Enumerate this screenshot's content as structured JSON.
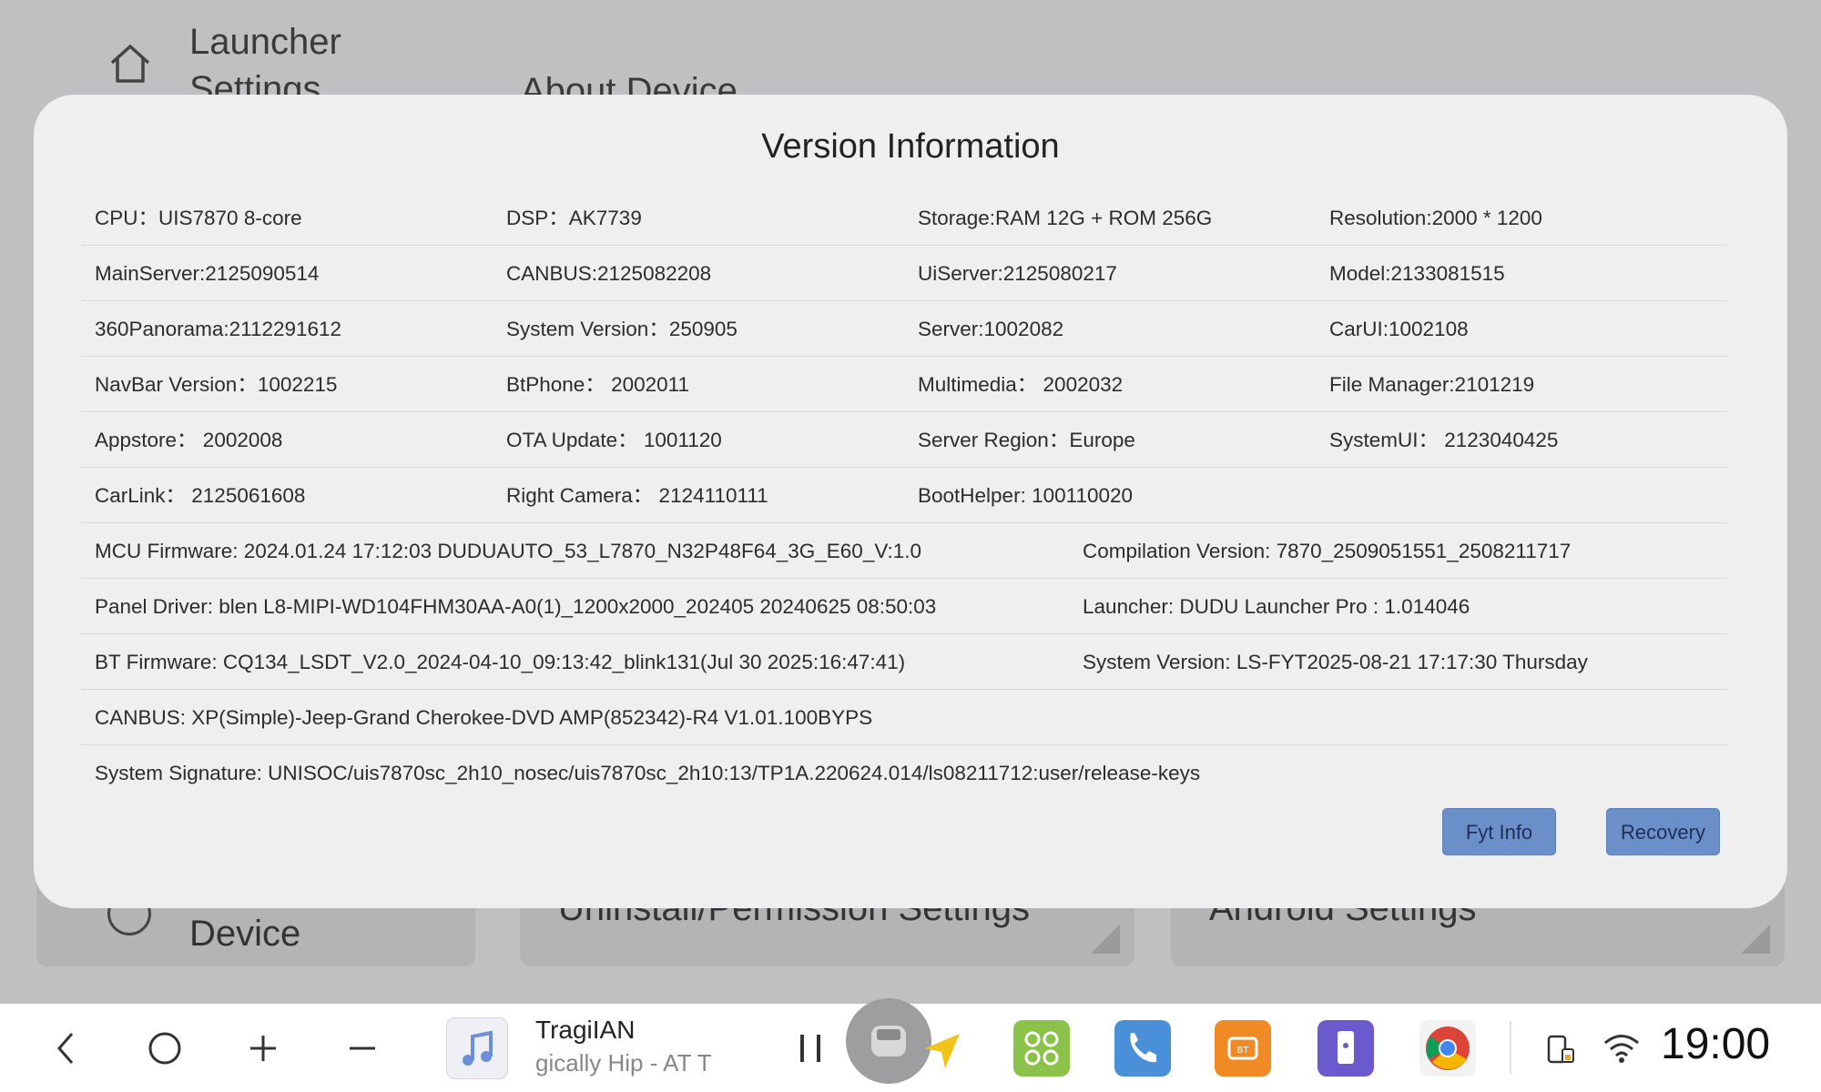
{
  "background": {
    "header_title": "Launcher Settings",
    "section_title": "About Device",
    "cards": [
      {
        "label": "Device"
      },
      {
        "label": "Uninstall/Permission Settings"
      },
      {
        "label": "Android Settings"
      }
    ]
  },
  "modal": {
    "title": "Version Information",
    "grid_rows": [
      [
        "CPU：UIS7870 8-core",
        "DSP：AK7739",
        "Storage:RAM 12G + ROM 256G",
        "Resolution:2000 * 1200"
      ],
      [
        "MainServer:2125090514",
        "CANBUS:2125082208",
        "UiServer:2125080217",
        "Model:2133081515"
      ],
      [
        "360Panorama:2112291612",
        "System Version：250905",
        "Server:1002082",
        "CarUI:1002108"
      ],
      [
        "NavBar Version：1002215",
        "BtPhone： 2002011",
        "Multimedia： 2002032",
        "File Manager:2101219"
      ],
      [
        "Appstore： 2002008",
        "OTA Update： 1001120",
        "Server Region：Europe",
        "SystemUI： 2123040425"
      ],
      [
        "CarLink： 2125061608",
        "Right Camera： 2124110111",
        "BootHelper: 100110020",
        ""
      ]
    ],
    "pair_rows": [
      [
        "MCU Firmware:  2024.01.24 17:12:03 DUDUAUTO_53_L7870_N32P48F64_3G_E60_V:1.0",
        "Compilation Version:  7870_2509051551_2508211717"
      ],
      [
        "Panel Driver:  blen L8-MIPI-WD104FHM30AA-A0(1)_1200x2000_202405 20240625 08:50:03",
        "Launcher:  DUDU Launcher Pro : 1.014046"
      ],
      [
        "BT Firmware:  CQ134_LSDT_V2.0_2024-04-10_09:13:42_blink131(Jul 30 2025:16:47:41)",
        "System Version:  LS-FYT2025-08-21 17:17:30 Thursday"
      ]
    ],
    "full_rows": [
      "CANBUS:  XP(Simple)-Jeep-Grand Cherokee-DVD AMP(852342)-R4 V1.01.100BYPS",
      "System Signature:  UNISOC/uis7870sc_2h10_nosec/uis7870sc_2h10:13/TP1A.220624.014/ls08211712:user/release-keys"
    ],
    "buttons": {
      "fyt_info": "Fyt Info",
      "recovery": "Recovery"
    }
  },
  "navbar": {
    "media_title": "TragiIAN",
    "media_subtitle": "gically Hip - AT T",
    "time": "19:00",
    "icons": [
      "back-icon",
      "home-icon",
      "volume-up-icon",
      "volume-down-icon",
      "music-app-icon",
      "pause-icon",
      "car-avatar-icon",
      "navigation-arrow-icon",
      "apps-grid-icon",
      "bt-phone-icon",
      "bt-music-icon",
      "phone-link-icon",
      "chrome-icon",
      "phone-charging-icon",
      "wifi-icon"
    ],
    "accent_colors": {
      "apps": "#8bc34a",
      "phone": "#4a90d9",
      "bt_music": "#f08a24",
      "phone_link": "#6a5acd"
    }
  }
}
